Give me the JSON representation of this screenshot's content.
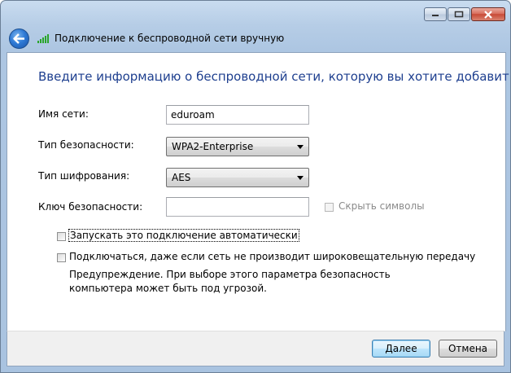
{
  "window": {
    "title": "Подключение к беспроводной сети вручную",
    "caption_buttons": {
      "minimize": "minimize",
      "maximize": "maximize",
      "close": "close"
    }
  },
  "heading": "Введите информацию о беспроводной сети, которую вы хотите добавить",
  "fields": {
    "network_name": {
      "label": "Имя сети:",
      "value": "eduroam"
    },
    "security_type": {
      "label": "Тип безопасности:",
      "value": "WPA2-Enterprise"
    },
    "encryption_type": {
      "label": "Тип шифрования:",
      "value": "AES"
    },
    "security_key": {
      "label": "Ключ безопасности:",
      "value": ""
    },
    "hide_characters": {
      "label": "Скрыть символы",
      "checked": false,
      "enabled": false
    }
  },
  "options": {
    "auto_connect": {
      "label": "Запускать это подключение автоматически",
      "checked": false
    },
    "connect_hidden": {
      "label": "Подключаться, даже если сеть не производит широковещательную передачу",
      "checked": false
    },
    "warning": "Предупреждение. При выборе этого параметра безопасность компьютера может быть под угрозой."
  },
  "buttons": {
    "next": "Далее",
    "cancel": "Отмена"
  },
  "icons": {
    "back": "back-arrow-icon",
    "signal": "wireless-signal-icon"
  },
  "colors": {
    "heading": "#1e3f8f",
    "frame": "#a9c3e0"
  }
}
